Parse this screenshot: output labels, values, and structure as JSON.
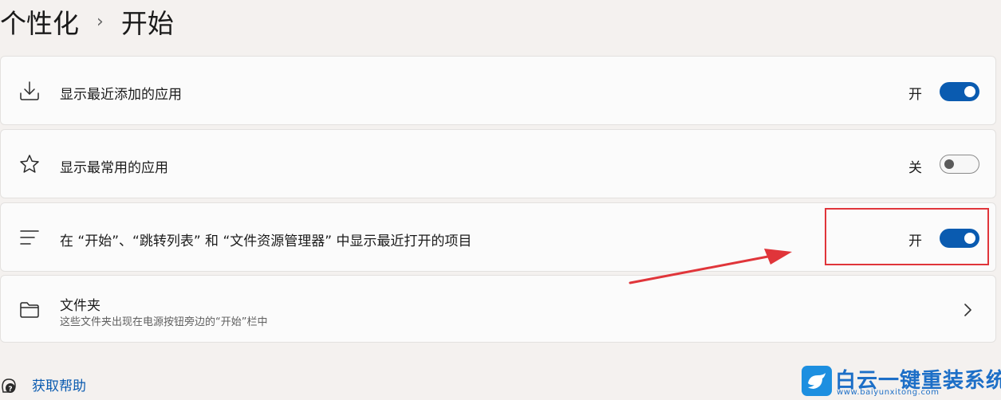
{
  "breadcrumb": {
    "parent": "个性化",
    "separator": "›",
    "current": "开始"
  },
  "settings": [
    {
      "label": "显示最近添加的应用",
      "state_label": "开",
      "toggle_on": true,
      "icon": "download-icon"
    },
    {
      "label": "显示最常用的应用",
      "state_label": "关",
      "toggle_on": false,
      "icon": "star-icon"
    },
    {
      "label": "在 “开始”、“跳转列表” 和 “文件资源管理器” 中显示最近打开的项目",
      "state_label": "开",
      "toggle_on": true,
      "icon": "list-icon"
    }
  ],
  "folders": {
    "title": "文件夹",
    "subtitle": "这些文件夹出现在电源按钮旁边的“开始”栏中",
    "icon": "folder-icon"
  },
  "help": {
    "label": "获取帮助",
    "icon": "help-icon"
  },
  "watermark": {
    "title": "白云一键重装系统",
    "url": "www.baiyunxitong.com",
    "icon": "bird-icon"
  },
  "colors": {
    "accent": "#0a5bb0",
    "annotation": "#e0353a",
    "background": "#f4f1ef",
    "card": "#fbfbfb"
  }
}
